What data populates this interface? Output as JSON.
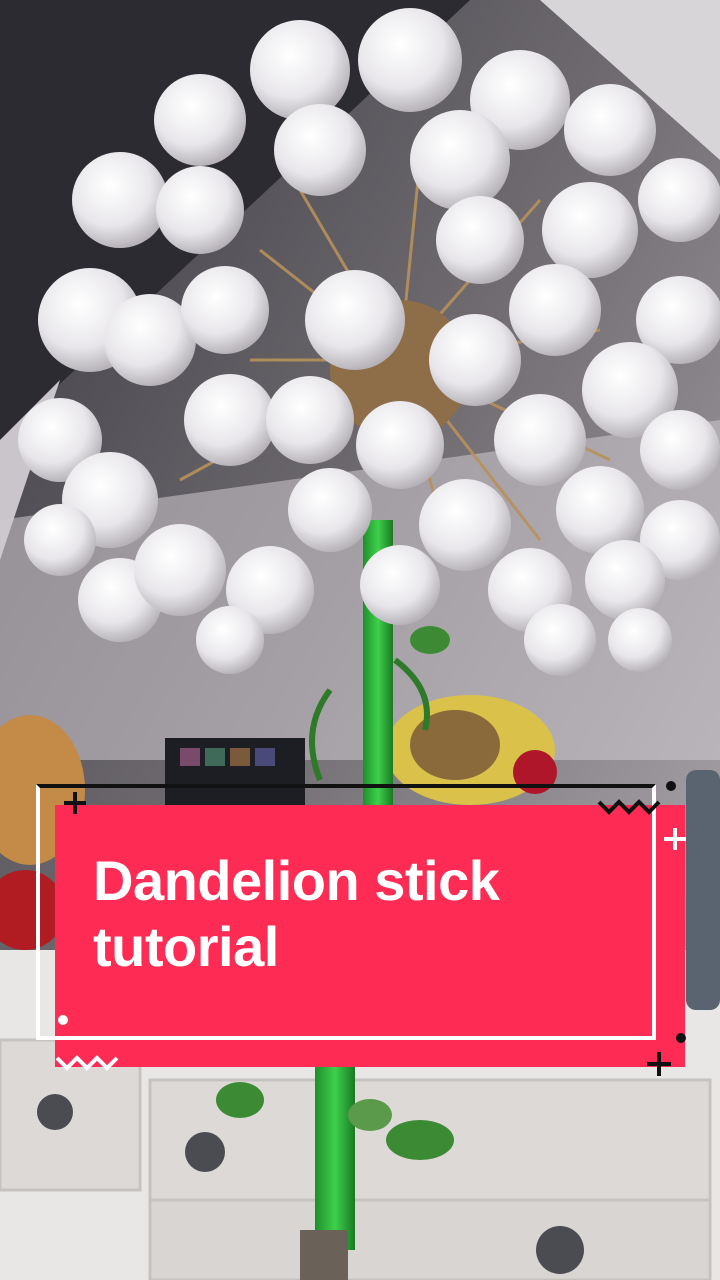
{
  "overlay": {
    "caption": "Dandelion stick tutorial",
    "accent_color": "#fe2c55",
    "text_color": "#ffffff"
  },
  "scene": {
    "subject": "dandelion-prop",
    "decoration_icons": [
      "plus-icon",
      "zigzag-icon",
      "dot-icon"
    ]
  }
}
